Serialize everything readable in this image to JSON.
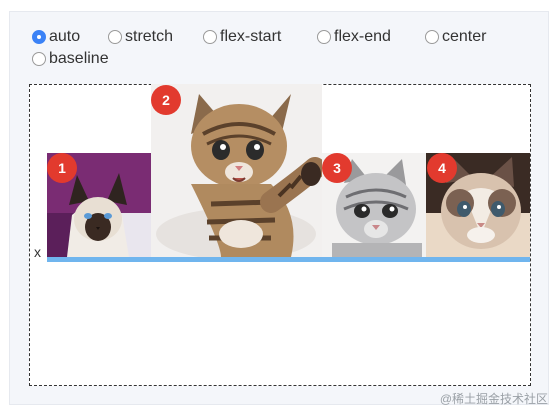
{
  "radio_options": [
    {
      "label": "auto",
      "checked": true
    },
    {
      "label": "stretch",
      "checked": false
    },
    {
      "label": "flex-start",
      "checked": false
    },
    {
      "label": "flex-end",
      "checked": false
    },
    {
      "label": "center",
      "checked": false
    },
    {
      "label": "baseline",
      "checked": false
    }
  ],
  "stage": {
    "x_marker": "x",
    "items": [
      {
        "badge": "1",
        "icon": "siamese-cat-image"
      },
      {
        "badge": "2",
        "icon": "tabby-kitten-image"
      },
      {
        "badge": "3",
        "icon": "silver-tabby-cat-image"
      },
      {
        "badge": "4",
        "icon": "ragdoll-cat-image"
      }
    ]
  },
  "colors": {
    "accent": "#3b82f6",
    "badge": "#e23a2e",
    "baseline_bar": "#70b5ee"
  },
  "watermark": "@稀土掘金技术社区"
}
